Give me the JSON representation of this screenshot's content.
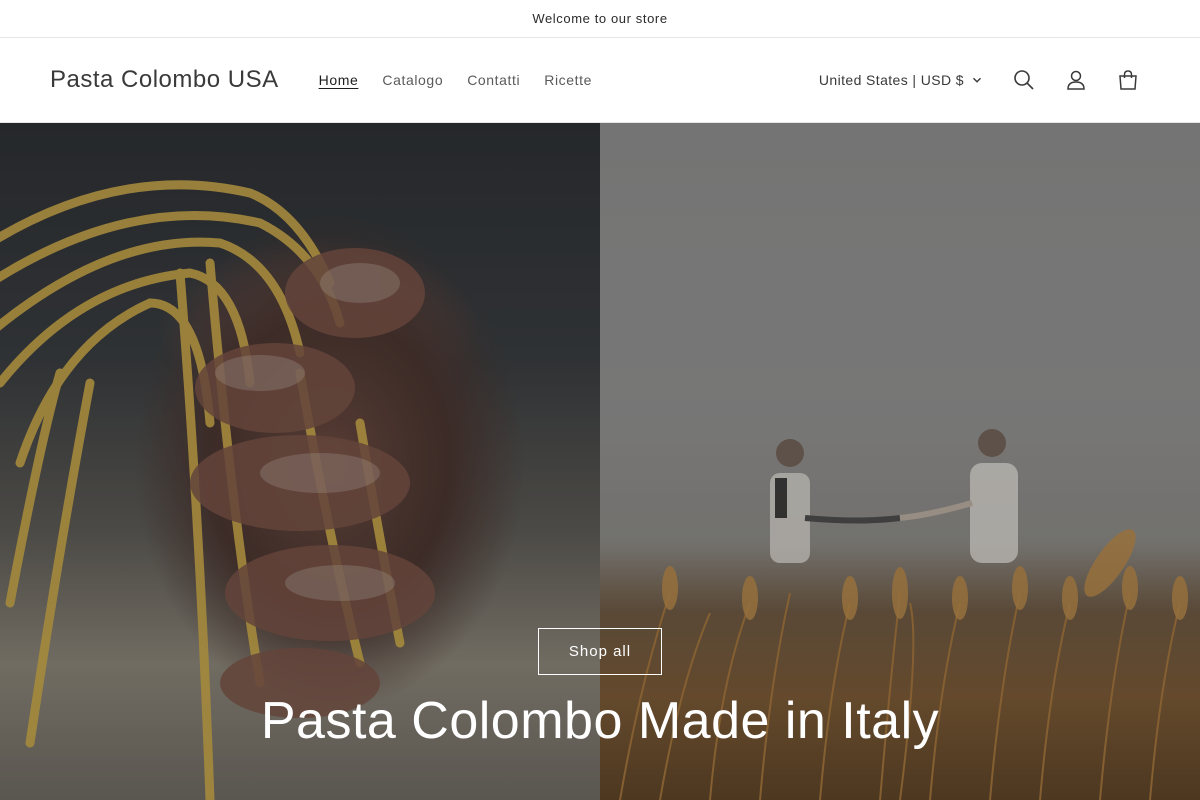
{
  "announcement": {
    "text": "Welcome to our store"
  },
  "header": {
    "logo": "Pasta Colombo USA",
    "nav": [
      {
        "label": "Home",
        "active": true
      },
      {
        "label": "Catalogo",
        "active": false
      },
      {
        "label": "Contatti",
        "active": false
      },
      {
        "label": "Ricette",
        "active": false
      }
    ],
    "country_selector": "United States | USD $",
    "icons": [
      "search-icon",
      "account-icon",
      "cart-icon"
    ]
  },
  "hero": {
    "button_label": "Shop all",
    "title": "Pasta Colombo Made in Italy",
    "images": [
      "hand-holding-pasta-image",
      "wheat-field-handshake-image"
    ]
  },
  "colors": {
    "text": "#121212",
    "border": "#e6e6e6",
    "hero_text": "#ffffff"
  }
}
